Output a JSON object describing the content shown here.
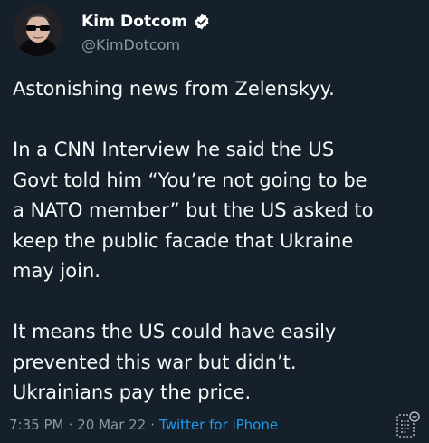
{
  "tweet": {
    "display_name": "Kim Dotcom",
    "handle": "@KimDotcom",
    "paragraphs": [
      [
        "Astonishing news from Zelenskyy."
      ],
      [
        "In a CNN Interview he said the US",
        "Govt told him “You’re not going to be",
        "a NATO member” but the US asked to",
        "keep the public facade that Ukraine",
        "may join."
      ],
      [
        "It means the US could have easily",
        "prevented this war but didn’t.",
        "Ukrainians pay the price."
      ]
    ],
    "time": "7:35 PM",
    "separator": "·",
    "date": "20 Mar 22",
    "source": "Twitter for iPhone"
  },
  "colors": {
    "background": "#15202b",
    "text": "#f7f9f9",
    "secondary_text": "#8b98a5",
    "link": "#1d9bf0",
    "verified_badge": "#ffffff"
  },
  "icons": {
    "verified": "verified-badge-icon",
    "reader_mode": "reader-mode-icon"
  }
}
